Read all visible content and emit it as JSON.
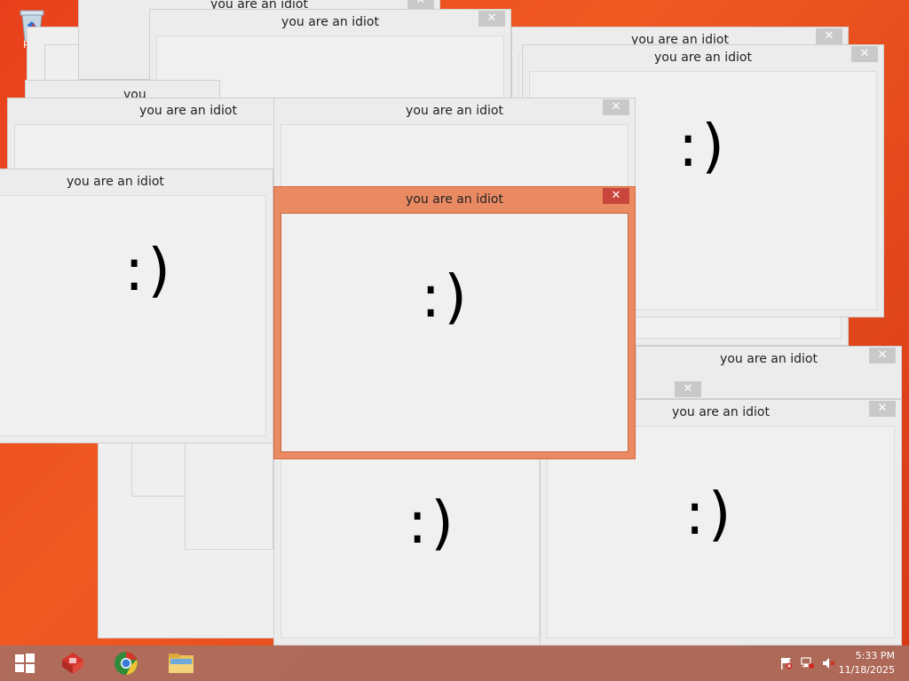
{
  "desktop": {
    "recycle_bin_label": "Rec"
  },
  "popup": {
    "title": "you are an idiot",
    "smiley": ":)",
    "close_glyph": "✕"
  },
  "taskbar": {
    "start_label": "Start",
    "apps": [
      "dropbox-app",
      "chrome-app",
      "file-explorer-app"
    ],
    "time": "5:33 PM",
    "date": "11/18/2025"
  },
  "colors": {
    "desktop_bg": "#e8401c",
    "active_frame": "#ea8a62",
    "active_close": "#c9463d",
    "inactive_close": "#c9c9c9"
  }
}
